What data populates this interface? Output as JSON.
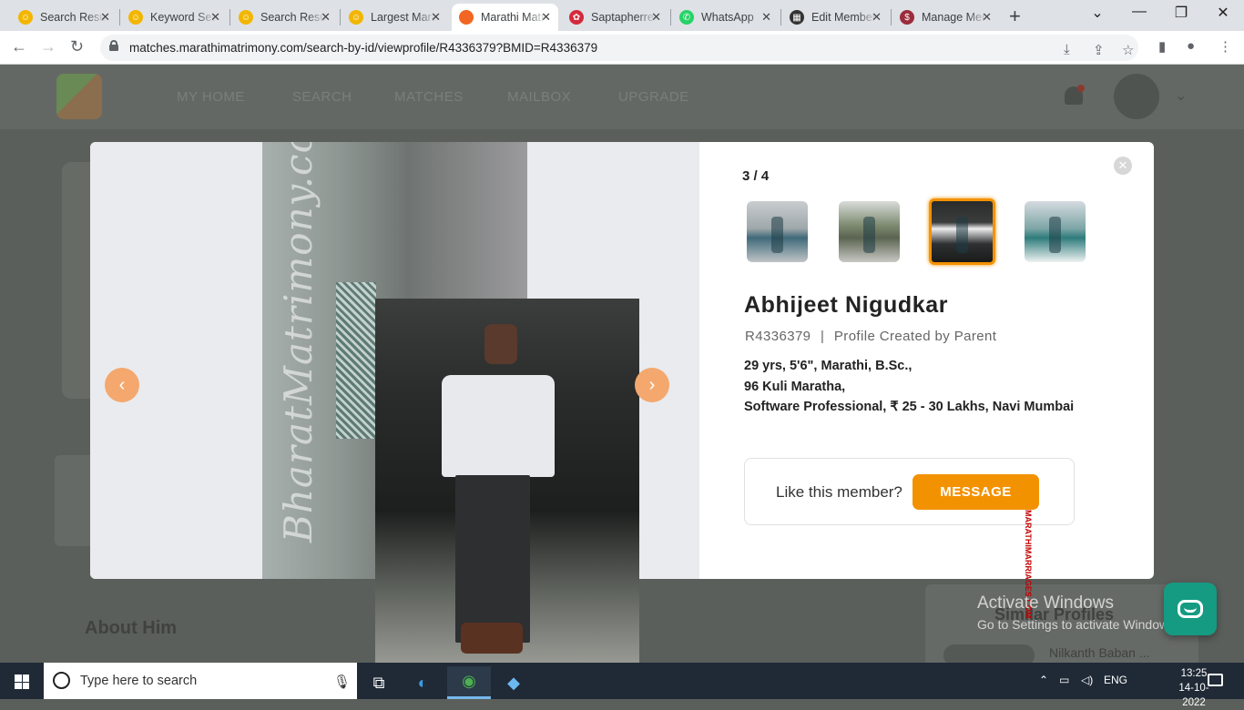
{
  "browser": {
    "tabs": [
      {
        "title": "Search Results",
        "fav": "#f2b600",
        "glyph": "☺"
      },
      {
        "title": "Keyword Search",
        "fav": "#f2b600",
        "glyph": "☺"
      },
      {
        "title": "Search Results",
        "fav": "#f2b600",
        "glyph": "☺"
      },
      {
        "title": "Largest Marathi",
        "fav": "#f2b600",
        "glyph": "☺"
      },
      {
        "title": "Marathi Matrimony",
        "fav": "#f26522",
        "glyph": "",
        "active": true
      },
      {
        "title": "Saptapherre",
        "fav": "#d42a3c",
        "glyph": "✿"
      },
      {
        "title": "WhatsApp",
        "fav": "#25d366",
        "glyph": "✆"
      },
      {
        "title": "Edit Member",
        "fav": "#333333",
        "glyph": "▦"
      },
      {
        "title": "Manage Members",
        "fav": "#9b2c3c",
        "glyph": "$"
      }
    ],
    "url": "matches.marathimatrimony.com/search-by-id/viewprofile/R4336379?BMID=R4336379"
  },
  "site_nav": {
    "items": [
      "MY HOME",
      "SEARCH",
      "MATCHES",
      "MAILBOX",
      "UPGRADE"
    ]
  },
  "gallery": {
    "watermark": "BharatMatrimony.com",
    "counter": "3 / 4",
    "selected_index": 3,
    "thumbnail_count": 4
  },
  "profile": {
    "name": "Abhijeet Nigudkar",
    "id": "R4336379",
    "separator": "|",
    "created_by": "Profile Created by Parent",
    "line1": "29 yrs, 5'6\", Marathi, B.Sc.,",
    "line2": "96 Kuli Maratha,",
    "line3": "Software Professional, ₹ 25 - 30 Lakhs,  Navi Mumbai"
  },
  "cta": {
    "question": "Like this member?",
    "button": "MESSAGE"
  },
  "stamp": "MARATHIMARRIAGES.COM",
  "background": {
    "about_title": "About Him",
    "similar_title": "Similar Profiles",
    "similar_name": "Nilkanth Baban ..."
  },
  "activation": {
    "title": "Activate Windows",
    "subtitle": "Go to Settings to activate Windows."
  },
  "taskbar": {
    "search_placeholder": "Type here to search",
    "lang": "ENG",
    "time": "13:25",
    "date": "14-10-2022"
  },
  "colors": {
    "accent": "#f39200",
    "carousel": "#f4a86e",
    "chat": "#159b82"
  }
}
